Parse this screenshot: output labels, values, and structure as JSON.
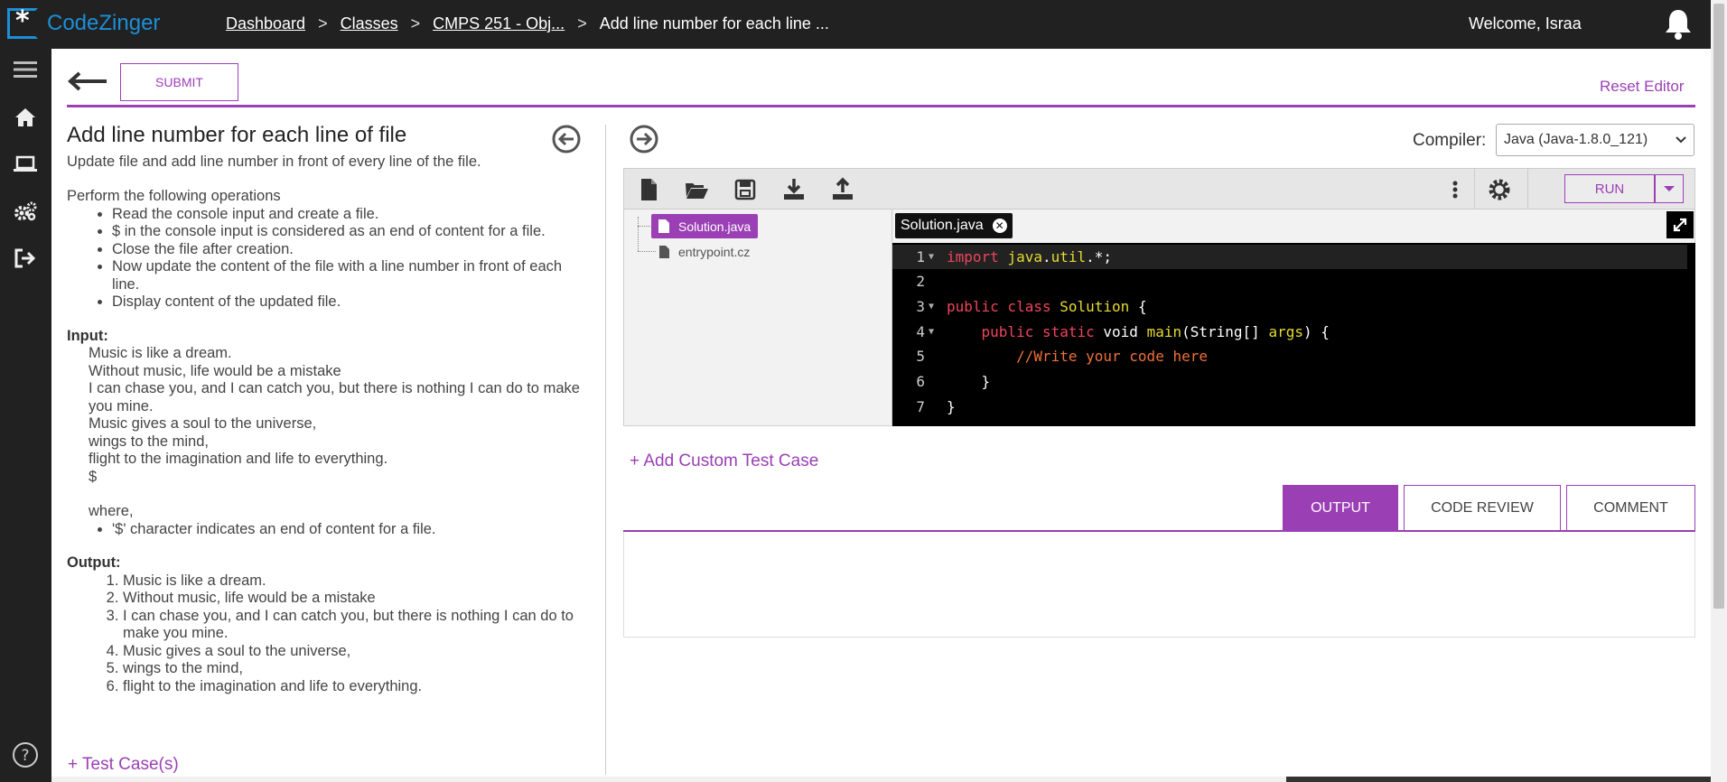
{
  "app": {
    "logo_text": "CodeZinger",
    "welcome": "Welcome, Israa",
    "accent": "#9b3fb5",
    "logo_color": "#1c8fd8"
  },
  "breadcrumb": {
    "items": [
      "Dashboard",
      "Classes",
      "CMPS 251 - Obj...",
      "Add line number for each line ..."
    ],
    "separator": ">"
  },
  "header": {
    "submit_label": "SUBMIT",
    "reset_label": "Reset Editor"
  },
  "problem": {
    "title": "Add line number for each line of file",
    "description": "Update file and add line number in front of every line of the file.",
    "operations_intro": "Perform the following operations",
    "operations": [
      "Read the console input and create a file.",
      "$ in the console input is considered as an end of content for a file.",
      "Close the file after creation.",
      "Now update the content of the file with a line number in front of each line.",
      "Display content of the updated file."
    ],
    "input_label": "Input:",
    "input_lines": [
      "Music is like a dream.",
      "Without music, life would be a mistake",
      "I can chase you, and I can catch you, but there is nothing I can do to make you mine.",
      "Music gives a soul to the universe,",
      "wings to the mind,",
      "flight to the imagination and life to everything.",
      "$"
    ],
    "where_label": "where,",
    "where_items": [
      "'$' character indicates an end of content for a file."
    ],
    "output_label": "Output:",
    "output_lines": [
      "Music is like a dream.",
      "Without music, life would be a mistake",
      "I can chase you, and I can catch you, but there is nothing I can do to make you mine.",
      "Music gives a soul to the universe,",
      "wings to the mind,",
      "flight to the imagination and life to everything."
    ],
    "test_cases_label": "+ Test Case(s)"
  },
  "editor": {
    "compiler_label": "Compiler:",
    "compiler_value": "Java (Java-1.8.0_121)",
    "run_label": "RUN",
    "files": [
      "Solution.java",
      "entrypoint.cz"
    ],
    "active_file": "Solution.java",
    "open_tab": "Solution.java",
    "code_lines": [
      "import java.util.*;",
      "",
      "public class Solution {",
      "    public static void main(String[] args) {",
      "        //Write your code here",
      "    }",
      "}"
    ],
    "line_numbers": [
      "1",
      "2",
      "3",
      "4",
      "5",
      "6",
      "7"
    ]
  },
  "tests": {
    "add_custom_label": "+ Add Custom Test Case"
  },
  "output_tabs": {
    "tabs": [
      "OUTPUT",
      "CODE REVIEW",
      "COMMENT"
    ],
    "active": "OUTPUT"
  },
  "icons": {
    "sidebar": [
      "menu-icon",
      "home-icon",
      "laptop-icon",
      "gears-icon",
      "sign-out-icon",
      "help-icon"
    ],
    "toolbar": [
      "new-file-icon",
      "open-folder-icon",
      "save-icon",
      "download-icon",
      "upload-icon",
      "more-vertical-icon",
      "settings-icon"
    ]
  }
}
